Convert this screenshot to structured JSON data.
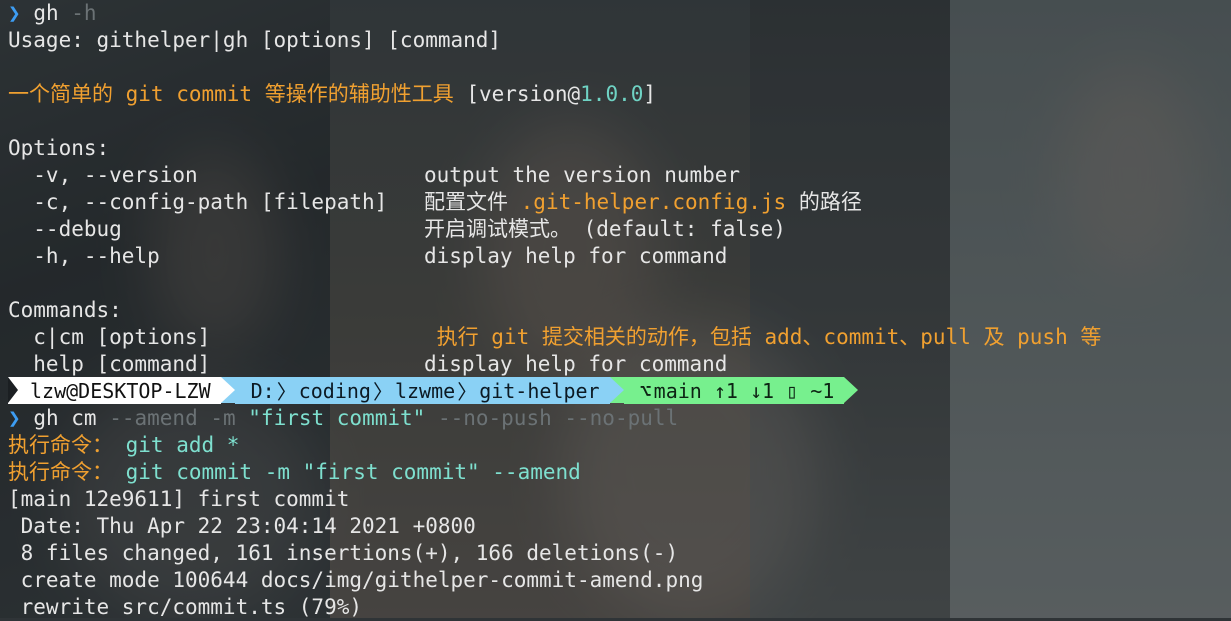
{
  "prompt_char": "❯",
  "cmd1": {
    "prog": "gh",
    "args": "-h"
  },
  "usage": "Usage: githelper|gh [options] [command]",
  "desc": {
    "text": "一个简单的 git commit 等操作的辅助性工具 ",
    "version_open": "[version@",
    "version_num": "1.0.0",
    "version_close": "]"
  },
  "options_header": "Options:",
  "options": [
    {
      "flag": "  -v, --version",
      "desc": "output the version number"
    },
    {
      "flag": "  -c, --config-path [filepath]",
      "desc_a": "配置文件 ",
      "desc_hl": ".git-helper.config.js",
      "desc_b": " 的路径"
    },
    {
      "flag": "  --debug",
      "desc": "开启调试模式。 (default: false)"
    },
    {
      "flag": "  -h, --help",
      "desc": "display help for command"
    }
  ],
  "commands_header": "Commands:",
  "commands": [
    {
      "name": "  c|cm [options]",
      "desc": " 执行 git 提交相关的动作，包括 add、commit、pull 及 push 等"
    },
    {
      "name": "  help [command]",
      "desc": "display help for command"
    }
  ],
  "promptbar": {
    "user": "lzw@DESKTOP-LZW",
    "path": [
      "D:",
      "coding",
      "lzwme",
      "git-helper"
    ],
    "branch_icon": "",
    "git": "main ↑1 ↓1 ▯ ~1"
  },
  "cmd2": {
    "prog": "gh",
    "sub": "cm",
    "args_grey1": " --amend -m ",
    "msg": "\"first commit\"",
    "args_grey2": " --no-push --no-pull"
  },
  "exec": [
    {
      "label": "执行命令：",
      "cmd": " git add *"
    },
    {
      "label": "执行命令：",
      "cmd": " git commit -m \"first commit\" --amend"
    }
  ],
  "output": [
    "[main 12e9611] first commit",
    " Date: Thu Apr 22 23:04:14 2021 +0800",
    " 8 files changed, 161 insertions(+), 166 deletions(-)",
    " create mode 100644 docs/img/githelper-commit-amend.png",
    " rewrite src/commit.ts (79%)"
  ]
}
